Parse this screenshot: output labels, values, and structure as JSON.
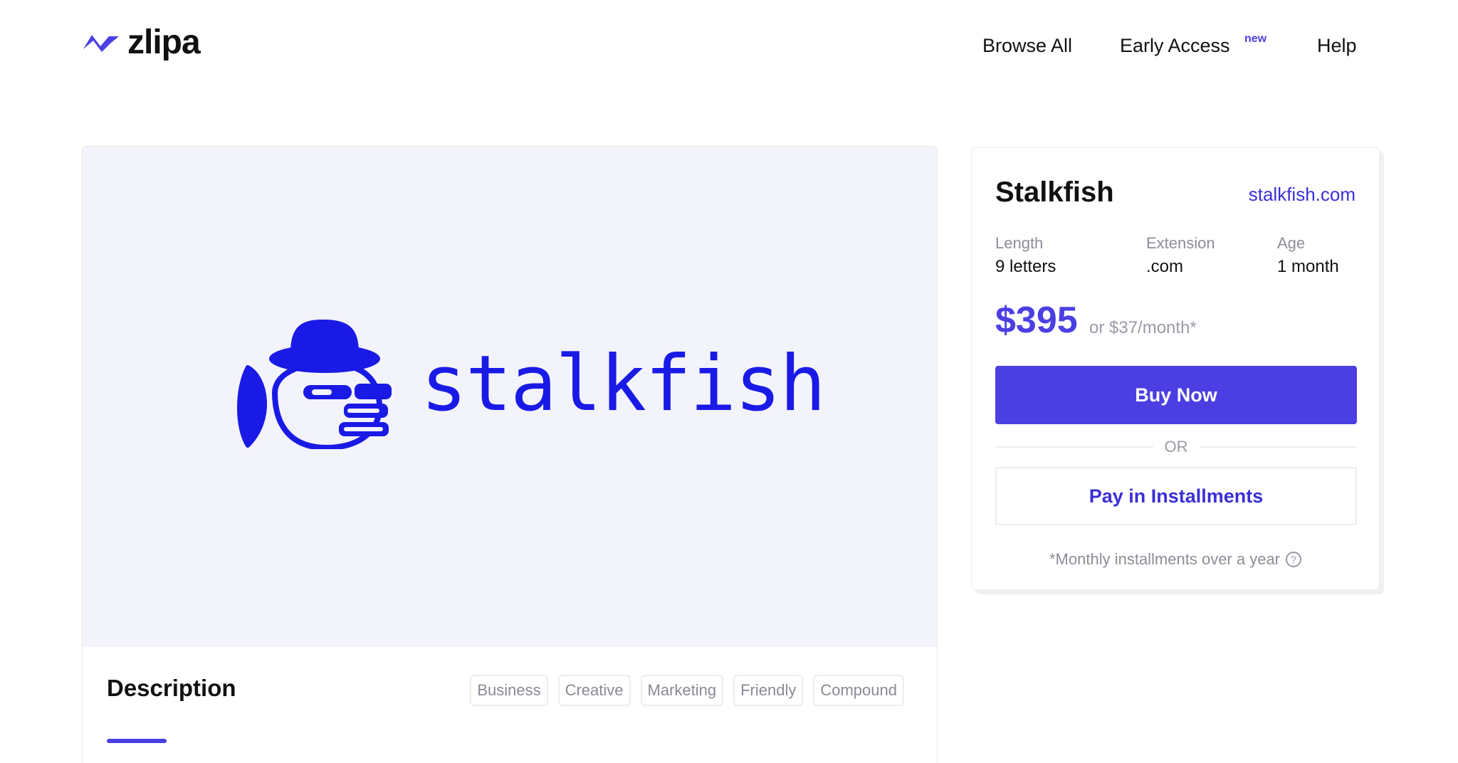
{
  "brand": {
    "name": "zlipa",
    "icon": "zlipa-logo-icon"
  },
  "nav": {
    "browse_all": "Browse All",
    "early_access": "Early Access",
    "early_access_badge": "new",
    "help": "Help"
  },
  "preview": {
    "logo_word": "stalkfish",
    "logo_icon": "stalkfish-fish-hat-icon",
    "logo_color": "#1a1ae6",
    "background": "#f3f3fb"
  },
  "description": {
    "title": "Description",
    "tags": [
      "Business",
      "Creative",
      "Marketing",
      "Friendly",
      "Compound"
    ]
  },
  "product": {
    "name": "Stalkfish",
    "domain_link": "stalkfish.com",
    "meta": [
      {
        "label": "Length",
        "value": "9 letters"
      },
      {
        "label": "Extension",
        "value": ".com"
      },
      {
        "label": "Age",
        "value": "1 month"
      }
    ],
    "price": "$395",
    "price_monthly": "or $37/month*",
    "buy_label": "Buy Now",
    "or_label": "OR",
    "installments_label": "Pay in Installments",
    "footnote": "*Monthly installments over a year",
    "help_icon": "question-circle-icon"
  },
  "colors": {
    "accent": "#4b3fe3",
    "link": "#3b2fd6",
    "muted": "#8d8d98"
  }
}
